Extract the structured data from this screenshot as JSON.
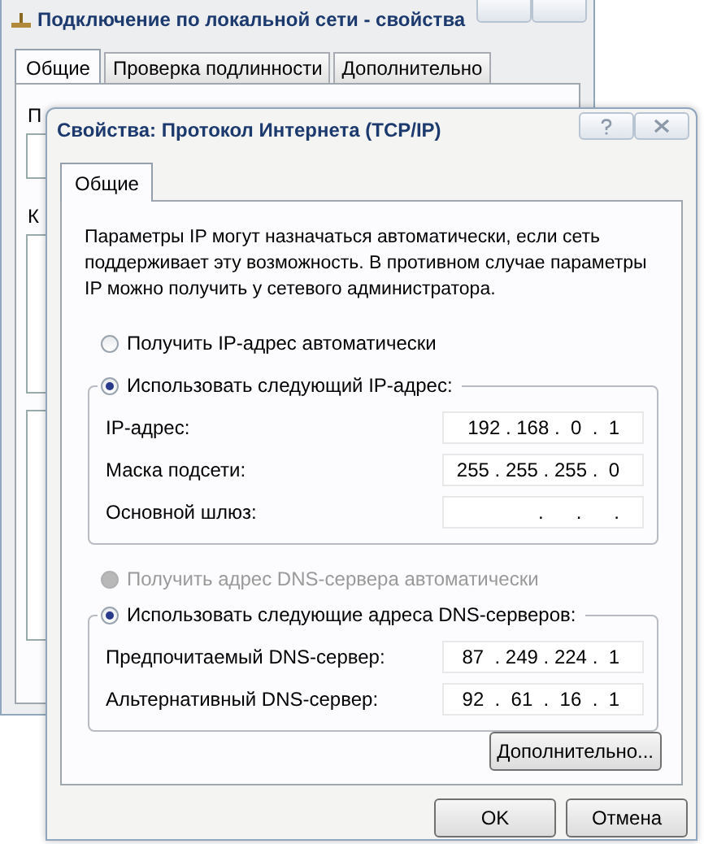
{
  "back_window": {
    "title": "Подключение по локальной сети - свойства",
    "tabs": [
      {
        "label": "Общие",
        "selected": true
      },
      {
        "label": "Проверка подлинности",
        "selected": false
      },
      {
        "label": "Дополнительно",
        "selected": false
      }
    ],
    "partial_labels": [
      "П",
      "К"
    ]
  },
  "front_window": {
    "title": "Свойства: Протокол Интернета (TCP/IP)",
    "tabs": [
      {
        "label": "Общие",
        "selected": true
      }
    ],
    "description": "Параметры IP могут назначаться автоматически, если сеть поддерживает эту возможность. В противном случае параметры IP можно получить у сетевого администратора.",
    "ip_options": [
      {
        "label": "Получить IP-адрес автоматически",
        "selected": false,
        "disabled": false
      },
      {
        "label": "Использовать следующий IP-адрес:",
        "selected": true,
        "disabled": false
      }
    ],
    "ip_fields": [
      {
        "label": "IP-адрес:",
        "value": "192 . 168 .  0  .  1"
      },
      {
        "label": "Маска подсети:",
        "value": "255 . 255 . 255 .  0"
      },
      {
        "label": "Основной шлюз:",
        "value": ".      .      ."
      }
    ],
    "dns_options": [
      {
        "label": "Получить адрес DNS-сервера автоматически",
        "selected": false,
        "disabled": true
      },
      {
        "label": "Использовать следующие адреса DNS-серверов:",
        "selected": true,
        "disabled": false
      }
    ],
    "dns_fields": [
      {
        "label": "Предпочитаемый DNS-сервер:",
        "value": "87  . 249 . 224 .  1"
      },
      {
        "label": "Альтернативный DNS-сервер:",
        "value": "92  .  61  .  16  .  1"
      }
    ],
    "advanced_button": "Дополнительно...",
    "buttons": [
      "OK",
      "Отмена"
    ]
  }
}
